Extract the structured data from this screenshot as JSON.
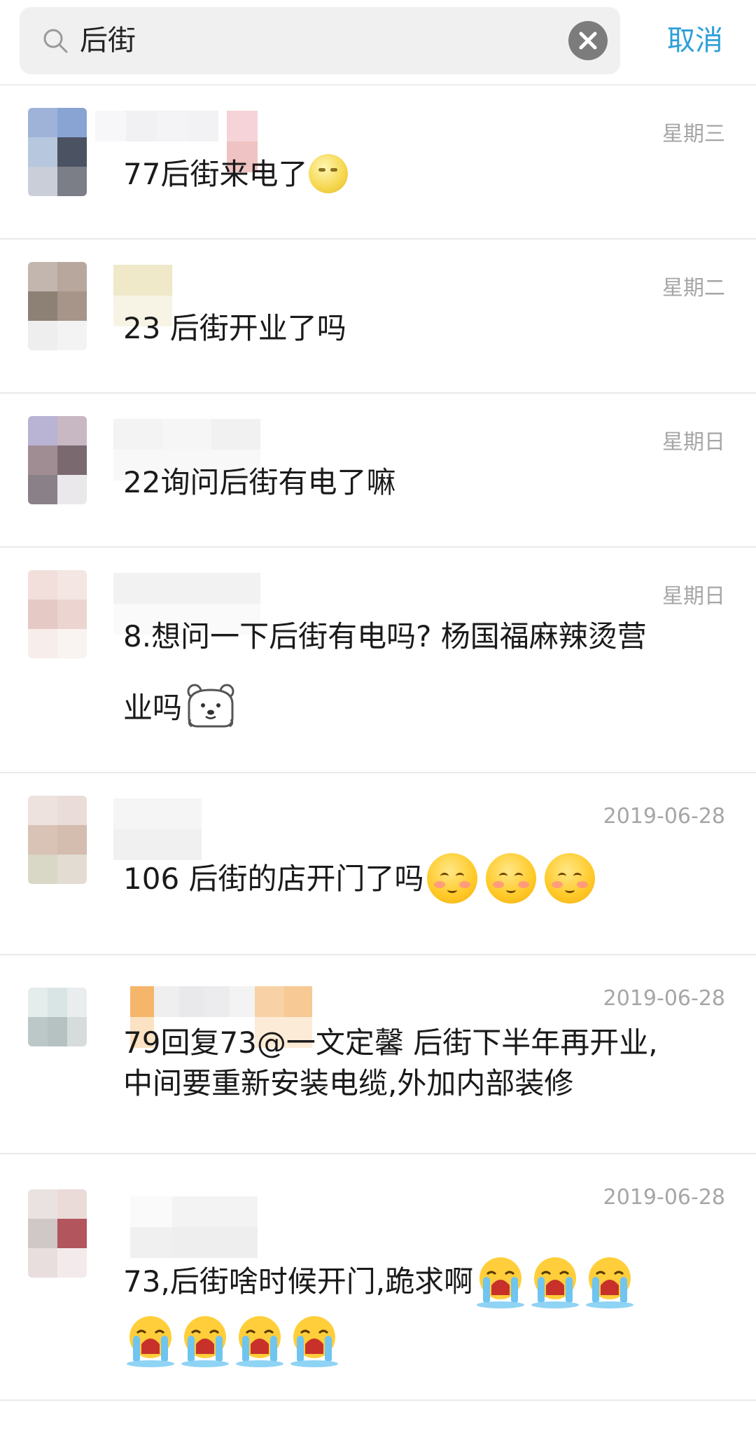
{
  "search": {
    "query": "后街",
    "cancel_label": "取消"
  },
  "results": [
    {
      "date": "星期三",
      "before_emoji": "77后街来电了",
      "after_emoji": "",
      "emoji": "moon-face"
    },
    {
      "date": "星期二",
      "before_emoji": "23 后街开业了吗",
      "after_emoji": "",
      "emoji": ""
    },
    {
      "date": "星期日",
      "before_emoji": "22询问后街有电了嘛",
      "after_emoji": "",
      "emoji": ""
    },
    {
      "date": "星期日",
      "line1": "8.想问一下后街有电吗? 杨国福麻辣烫营",
      "line2": "业吗",
      "emoji": "polar-bear"
    },
    {
      "date": "2019-06-28",
      "before_emoji": "106 后街的店开门了吗",
      "emoji": "shy-face",
      "emoji_count": 3
    },
    {
      "date": "2019-06-28",
      "line1": "79回复73@一文定馨 后街下半年再开业,",
      "line2": "中间要重新安装电缆,外加内部装修",
      "emoji": ""
    },
    {
      "date": "2019-06-28",
      "before_emoji": "73,后街啥时候开门,跪求啊",
      "emoji": "crying-face",
      "emoji_count": 7
    }
  ],
  "colors": {
    "accent": "#2f9fd8",
    "timestamp": "#a6a6a6",
    "divider": "#e9e9e9"
  }
}
